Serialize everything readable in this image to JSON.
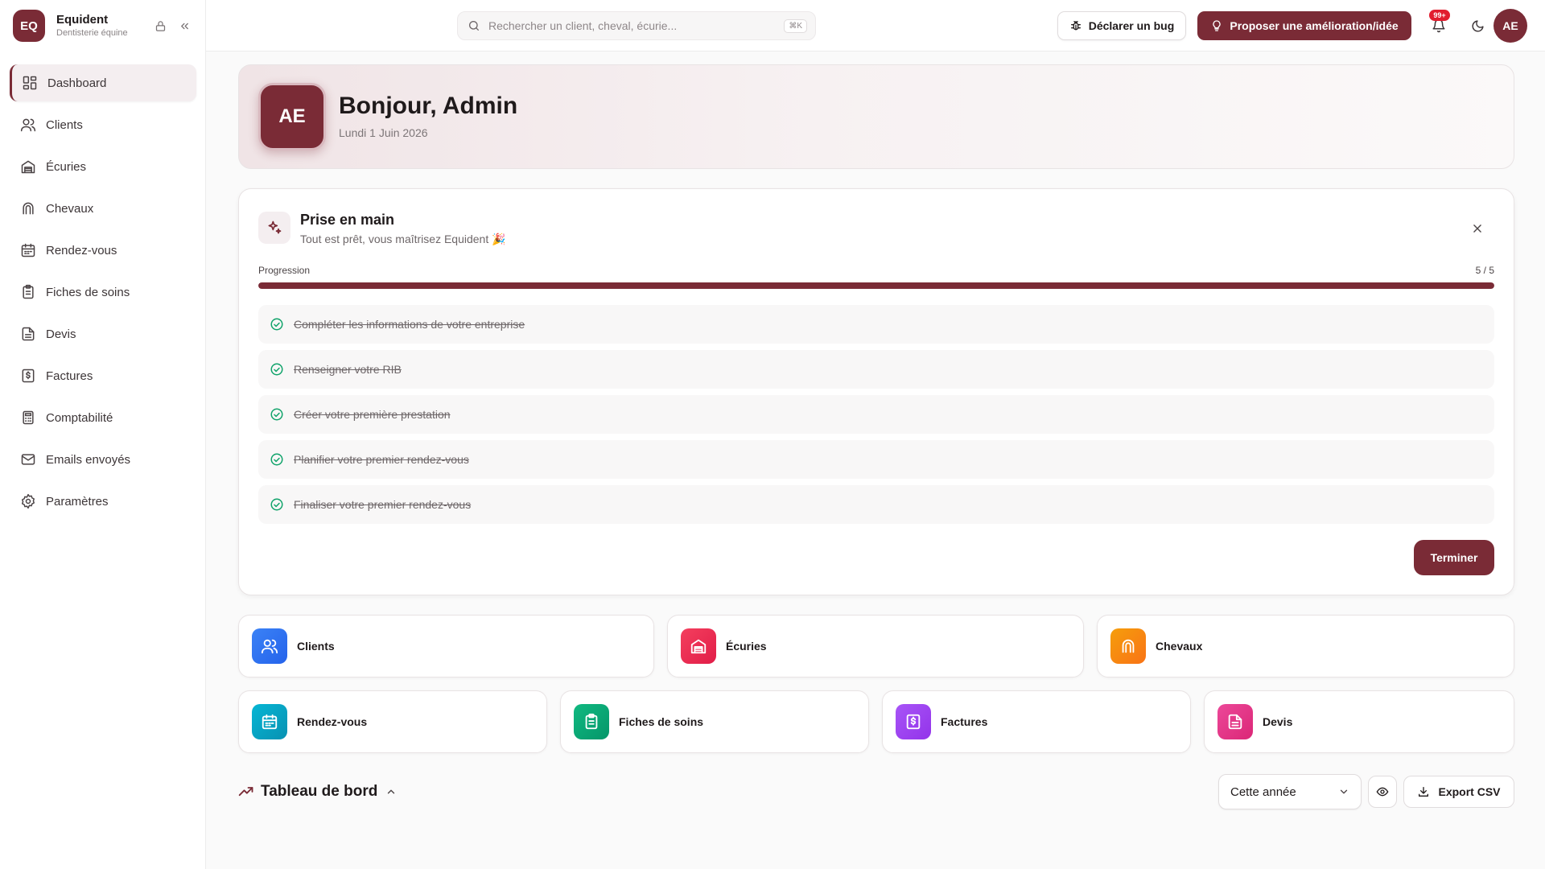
{
  "brand": {
    "logo_text": "EQ",
    "name": "Equident",
    "subtitle": "Dentisterie équine"
  },
  "sidebar": {
    "items": [
      {
        "label": "Dashboard",
        "icon": "dashboard-icon",
        "active": true
      },
      {
        "label": "Clients",
        "icon": "users-icon"
      },
      {
        "label": "Écuries",
        "icon": "stable-icon"
      },
      {
        "label": "Chevaux",
        "icon": "horseshoe-icon"
      },
      {
        "label": "Rendez-vous",
        "icon": "calendar-icon"
      },
      {
        "label": "Fiches de soins",
        "icon": "clipboard-icon"
      },
      {
        "label": "Devis",
        "icon": "document-icon"
      },
      {
        "label": "Factures",
        "icon": "invoice-icon"
      },
      {
        "label": "Comptabilité",
        "icon": "calculator-icon"
      },
      {
        "label": "Emails envoyés",
        "icon": "mail-icon"
      },
      {
        "label": "Paramètres",
        "icon": "gear-icon"
      }
    ]
  },
  "header": {
    "search_placeholder": "Rechercher un client, cheval, écurie...",
    "search_shortcut": "⌘K",
    "bug_label": "Déclarer un bug",
    "idea_label": "Proposer une amélioration/idée",
    "notif_count": "99+",
    "avatar": "AE"
  },
  "welcome": {
    "avatar": "AE",
    "greeting": "Bonjour, Admin",
    "date": "Lundi 1 Juin 2026"
  },
  "onboarding": {
    "title": "Prise en main",
    "subtitle": "Tout est prêt, vous maîtrisez Equident 🎉",
    "progress_label": "Progression",
    "progress_text": "5 / 5",
    "progress_fraction": 1.0,
    "steps": [
      "Compléter les informations de votre entreprise",
      "Renseigner votre RIB",
      "Créer votre première prestation",
      "Planifier votre premier rendez-vous",
      "Finaliser votre premier rendez-vous"
    ],
    "finish_label": "Terminer"
  },
  "quick_access": {
    "row1": [
      {
        "label": "Clients",
        "icon": "users-icon",
        "color": "#3b82f6"
      },
      {
        "label": "Écuries",
        "icon": "stable-icon",
        "color": "#f43f5e"
      },
      {
        "label": "Chevaux",
        "icon": "horseshoe-icon",
        "color": "#f59e0b"
      }
    ],
    "row2": [
      {
        "label": "Rendez-vous",
        "icon": "calendar-icon",
        "color": "#06b6d4"
      },
      {
        "label": "Fiches de soins",
        "icon": "clipboard-icon",
        "color": "#10b981"
      },
      {
        "label": "Factures",
        "icon": "invoice-icon",
        "color": "#a855f7"
      },
      {
        "label": "Devis",
        "icon": "document-icon",
        "color": "#ec4899"
      }
    ]
  },
  "dashboard": {
    "title": "Tableau de bord",
    "period": "Cette année",
    "export_label": "Export CSV"
  },
  "colors": {
    "accent": "#7a2b36",
    "success": "#10a36a"
  }
}
